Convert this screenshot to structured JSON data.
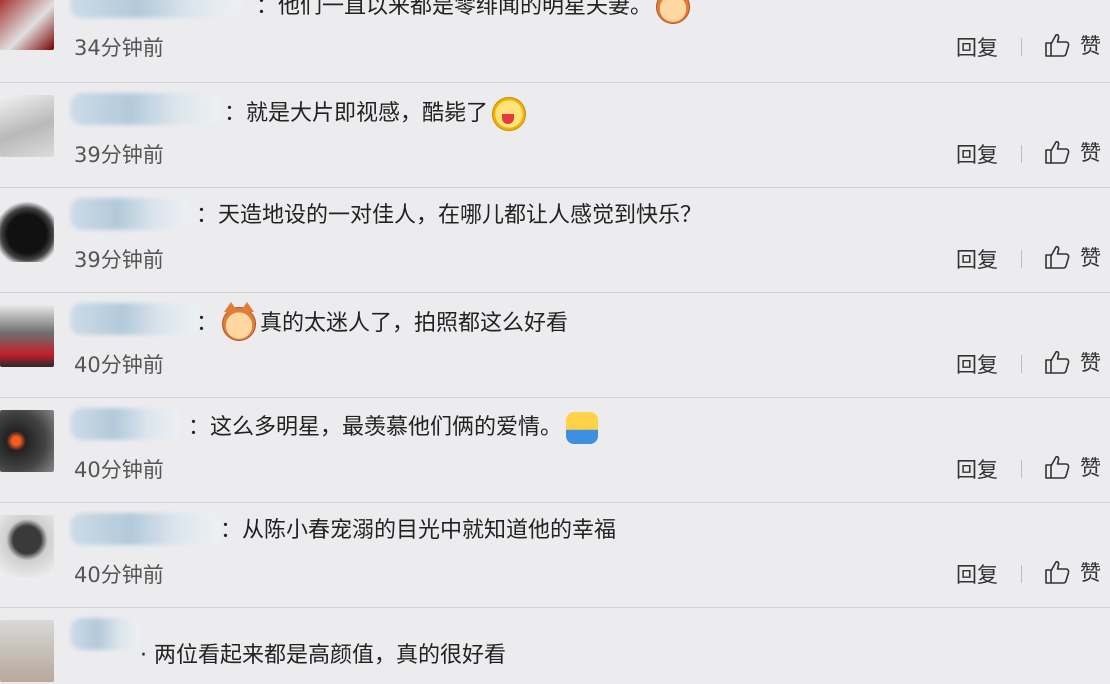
{
  "comments": [
    {
      "text": "：他们一直以来都是零绯闻的明星夫妻。",
      "emoji": "cat-face-icon",
      "time": "34分钟前",
      "reply": "回复",
      "like": "赞"
    },
    {
      "text": "：就是大片即视感，酷毙了",
      "emoji": "tongue-face-icon",
      "time": "39分钟前",
      "reply": "回复",
      "like": "赞"
    },
    {
      "text": "：天造地设的一对佳人，在哪儿都让人感觉到快乐？",
      "emoji": "",
      "time": "39分钟前",
      "reply": "回复",
      "like": "赞"
    },
    {
      "text_before": "：",
      "emoji": "cat-face-icon",
      "text": "真的太迷人了，拍照都这么好看",
      "time": "40分钟前",
      "reply": "回复",
      "like": "赞"
    },
    {
      "text": "：这么多明星，最羡慕他们俩的爱情。",
      "emoji": "person-icon",
      "time": "40分钟前",
      "reply": "回复",
      "like": "赞"
    },
    {
      "text": "：从陈小春宠溺的目光中就知道他的幸福",
      "emoji": "",
      "time": "40分钟前",
      "reply": "回复",
      "like": "赞"
    },
    {
      "text": "· 两位看起来都是高颜值，真的很好看",
      "emoji": "",
      "time": "",
      "reply": "",
      "like": ""
    }
  ],
  "colors": {
    "background": "#ececef",
    "divider": "#d4d4d8",
    "text": "#222222",
    "meta": "#555555"
  }
}
